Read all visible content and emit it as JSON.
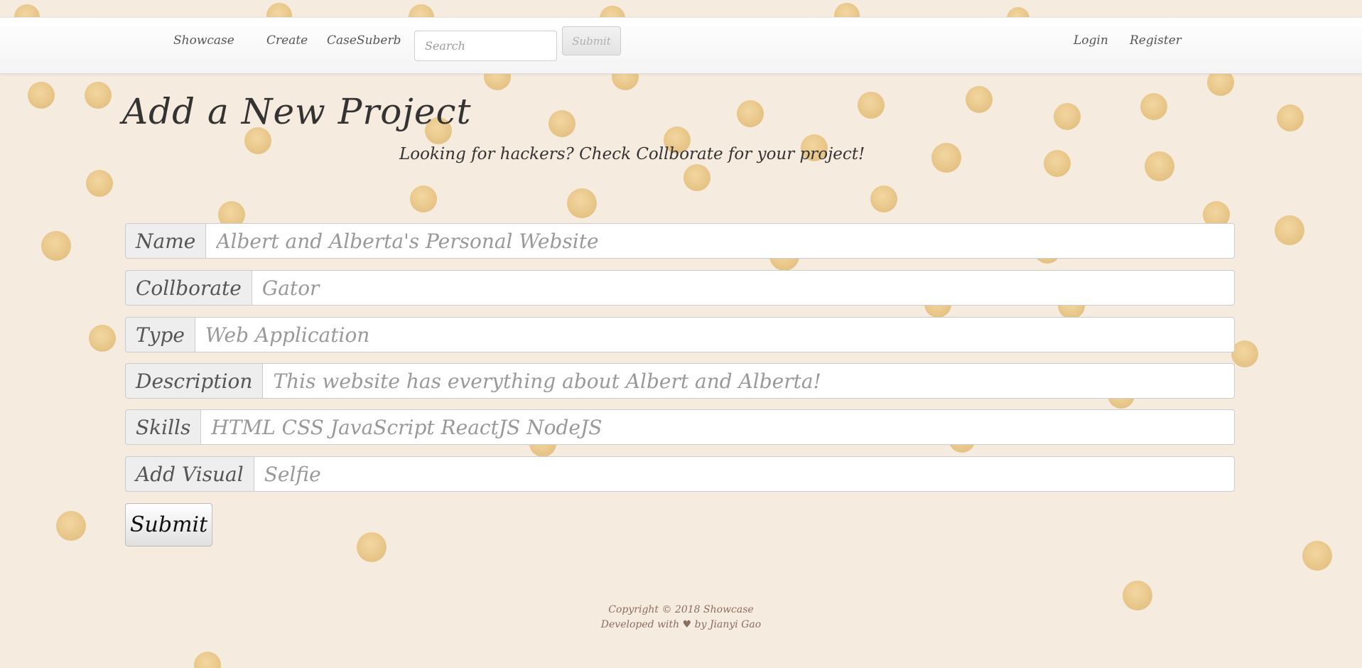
{
  "nav": {
    "brand": "Showcase",
    "links": [
      "Create",
      "CaseSuberb"
    ],
    "search_placeholder": "Search",
    "search_button": "Submit",
    "auth": [
      "Login",
      "Register"
    ]
  },
  "page": {
    "title": "Add a New Project",
    "subtitle": "Looking for hackers?  Check Collborate for your project!"
  },
  "form": {
    "fields": [
      {
        "label": "Name",
        "placeholder": "Albert and Alberta's Personal Website"
      },
      {
        "label": "Collborate",
        "placeholder": "Gator"
      },
      {
        "label": "Type",
        "placeholder": "Web Application"
      },
      {
        "label": "Description",
        "placeholder": "This website has everything about Albert and Alberta!"
      },
      {
        "label": "Skills",
        "placeholder": "HTML CSS JavaScript ReactJS NodeJS"
      },
      {
        "label": "Add Visual",
        "placeholder": "Selfie"
      }
    ],
    "submit_label": "Submit"
  },
  "footer": {
    "line1": "Copyright © 2018 Showcase",
    "line2": "Developed with ♥ by Jianyi Gao"
  },
  "colors": {
    "background": "#f7ece0",
    "dots": "#eac98a"
  }
}
